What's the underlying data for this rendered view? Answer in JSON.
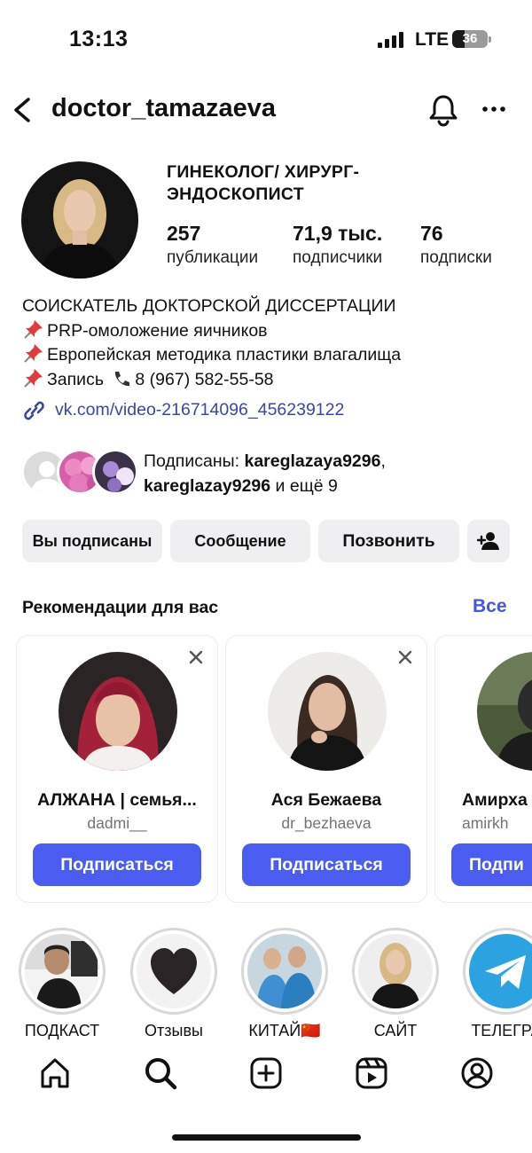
{
  "status_bar": {
    "time": "13:13",
    "network": "LTE",
    "battery_level": "36",
    "battery_fraction": 0.36,
    "signal_icon": "signal-bars-icon"
  },
  "header": {
    "username": "doctor_tamazaeva",
    "back_icon": "chevron-left-icon",
    "notifications_icon": "bell-icon",
    "more_icon": "more-dots-icon"
  },
  "profile": {
    "title": "ГИНЕКОЛОГ/ ХИРУРГ-ЭНДОСКОПИСТ",
    "stats": [
      {
        "value": "257",
        "label": "публикации"
      },
      {
        "value": "71,9 тыс.",
        "label": "подписчики"
      },
      {
        "value": "76",
        "label": "подписки"
      }
    ],
    "bio": {
      "line1": "СОИСКАТЕЛЬ ДОКТОРСКОЙ ДИССЕРТАЦИИ",
      "line2": "PRP-омоложение яичников",
      "line3": "Европейская методика пластики влагалища",
      "line4_a": "Запись",
      "line4_b": "8 (967) 582-55-58",
      "link": "vk.com/video-216714096_456239122"
    },
    "followed_by": {
      "prefix": "Подписаны: ",
      "user1": "kareglazaya9296",
      "sep": ",",
      "user2": "kareglazay9296",
      "suffix": " и ещё 9"
    }
  },
  "actions": {
    "following": "Вы подписаны",
    "message": "Сообщение",
    "call": "Позвонить",
    "add_user_icon": "add-person-icon"
  },
  "recommendations": {
    "title": "Рекомендации для вас",
    "see_all": "Все",
    "follow_label": "Подписаться",
    "follow_label_partial": "Подпи",
    "cards": [
      {
        "name": "АЛЖАНА | семья...",
        "handle": "dadmi__"
      },
      {
        "name": "Ася Бежаева",
        "handle": "dr_bezhaeva"
      },
      {
        "name": "Амирха",
        "handle": "amirkh"
      }
    ]
  },
  "highlights": [
    {
      "label": "ПОДКАСТ"
    },
    {
      "label": "Отзывы"
    },
    {
      "label": "КИТАЙ🇨🇳"
    },
    {
      "label": "САЙТ"
    },
    {
      "label": "ТЕЛЕГРА"
    }
  ],
  "tabbar": {
    "home": "home-icon",
    "search": "search-icon",
    "create": "plus-square-icon",
    "reels": "reels-icon",
    "profile": "profile-icon"
  },
  "colors": {
    "link": "#3a46a8",
    "accent": "#4255e8",
    "follow_button": "#4a5df0",
    "button_bg": "#efeff2"
  }
}
